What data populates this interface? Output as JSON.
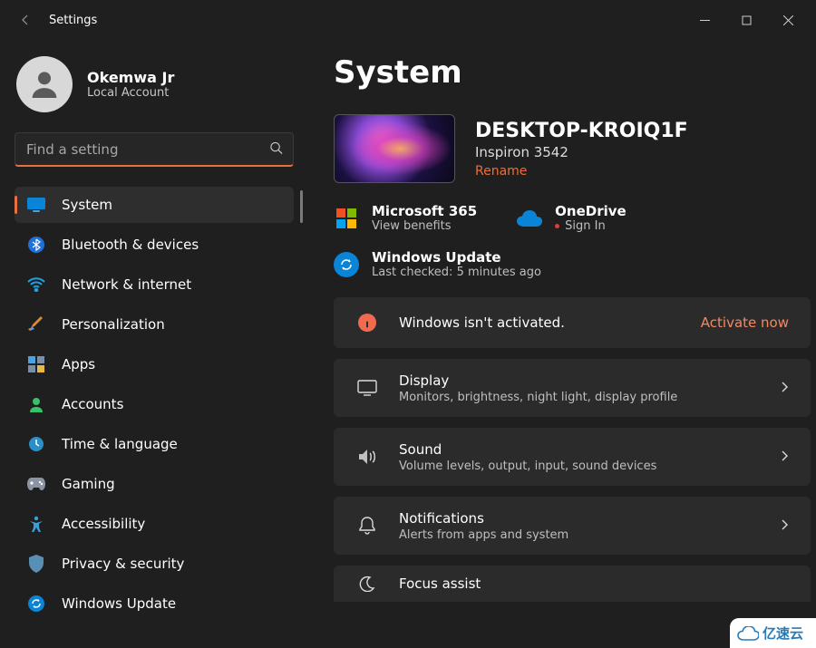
{
  "window": {
    "title": "Settings"
  },
  "profile": {
    "name": "Okemwa Jr",
    "sub": "Local Account"
  },
  "search": {
    "placeholder": "Find a setting"
  },
  "nav": [
    {
      "id": "system",
      "label": "System",
      "active": true
    },
    {
      "id": "bluetooth",
      "label": "Bluetooth & devices"
    },
    {
      "id": "network",
      "label": "Network & internet"
    },
    {
      "id": "personalization",
      "label": "Personalization"
    },
    {
      "id": "apps",
      "label": "Apps"
    },
    {
      "id": "accounts",
      "label": "Accounts"
    },
    {
      "id": "time",
      "label": "Time & language"
    },
    {
      "id": "gaming",
      "label": "Gaming"
    },
    {
      "id": "accessibility",
      "label": "Accessibility"
    },
    {
      "id": "privacy",
      "label": "Privacy & security"
    },
    {
      "id": "update",
      "label": "Windows Update"
    }
  ],
  "page": {
    "title": "System"
  },
  "device": {
    "name": "DESKTOP-KROIQ1F",
    "model": "Inspiron 3542",
    "rename": "Rename"
  },
  "services": {
    "m365": {
      "title": "Microsoft 365",
      "sub": "View benefits"
    },
    "onedrive": {
      "title": "OneDrive",
      "sub": "Sign In"
    }
  },
  "update": {
    "title": "Windows Update",
    "sub": "Last checked: 5 minutes ago"
  },
  "activation": {
    "message": "Windows isn't activated.",
    "action": "Activate now"
  },
  "cards": {
    "display": {
      "title": "Display",
      "sub": "Monitors, brightness, night light, display profile"
    },
    "sound": {
      "title": "Sound",
      "sub": "Volume levels, output, input, sound devices"
    },
    "notifications": {
      "title": "Notifications",
      "sub": "Alerts from apps and system"
    },
    "focus": {
      "title": "Focus assist"
    }
  },
  "watermark": "亿速云",
  "colors": {
    "accent": "#e86f3f"
  }
}
